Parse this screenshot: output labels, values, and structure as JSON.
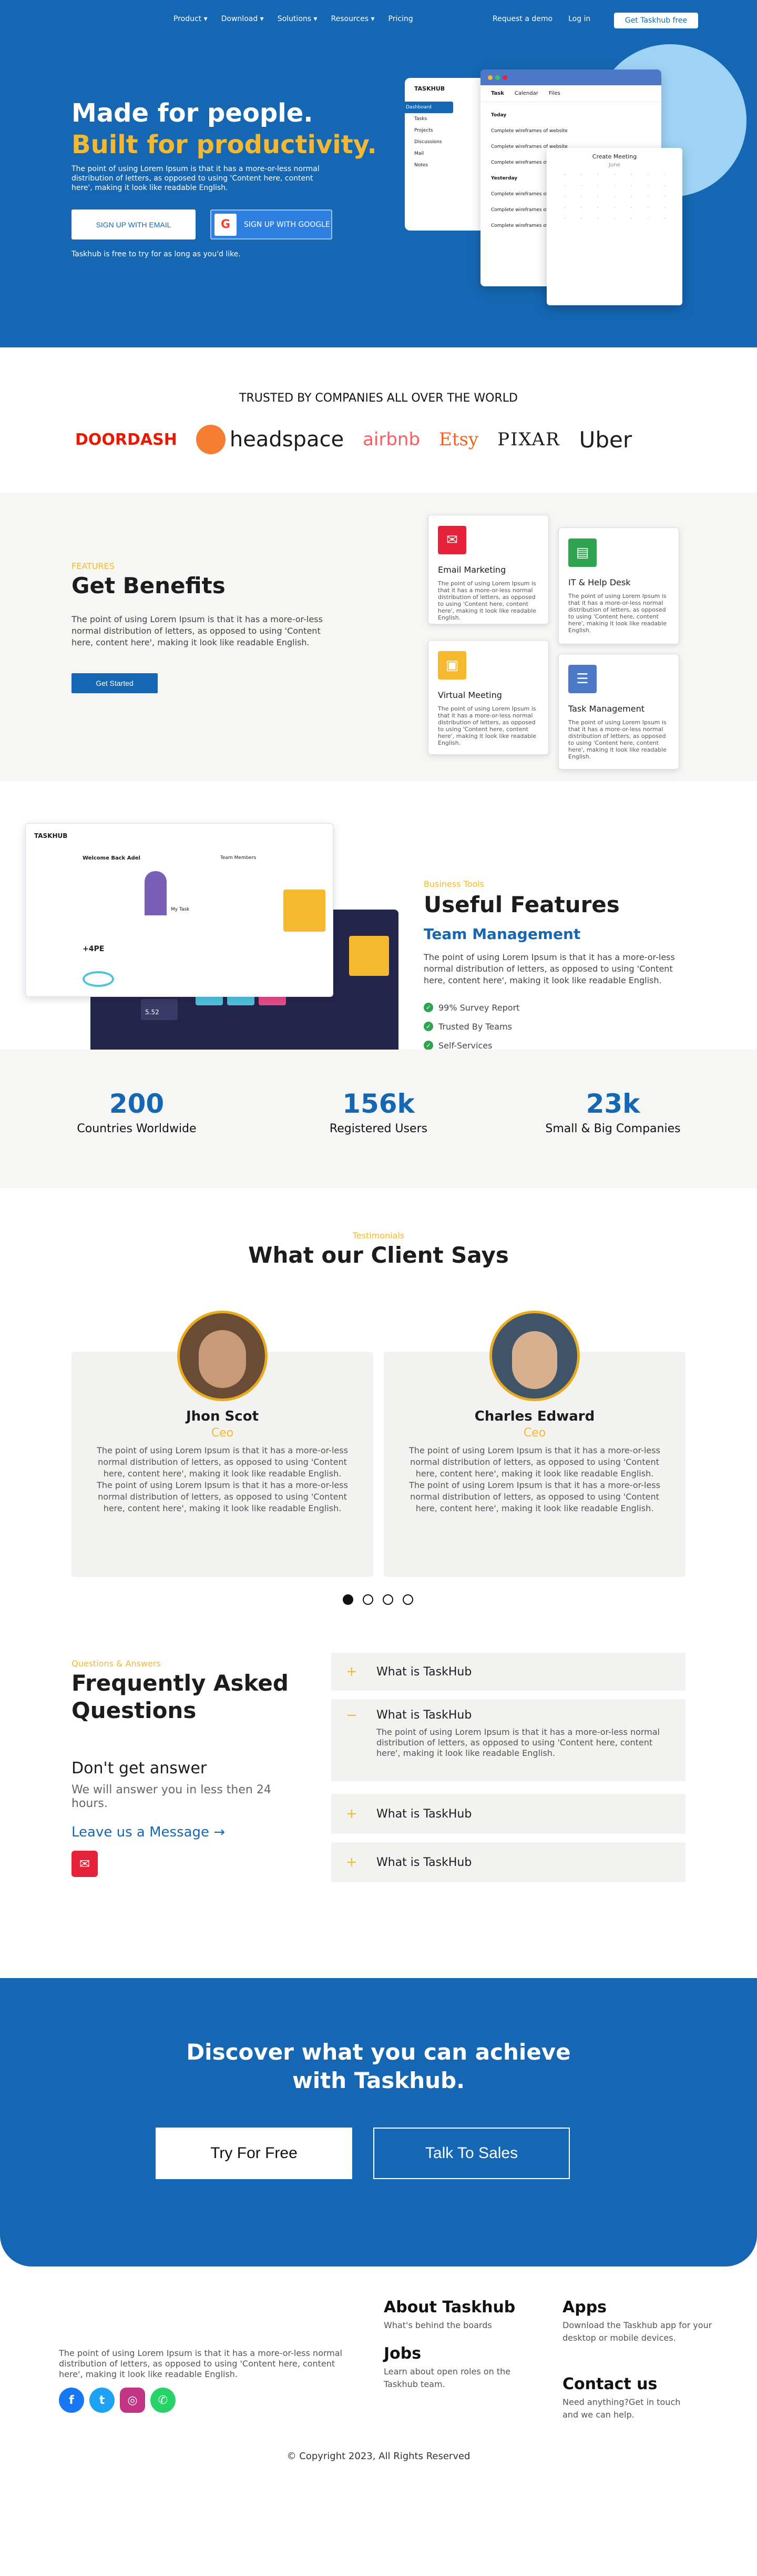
{
  "nav": {
    "links": [
      "Product ▾",
      "Download ▾",
      "Solutions ▾",
      "Resources ▾",
      "Pricing"
    ],
    "demo": "Request a demo",
    "login": "Log in",
    "cta": "Get Taskhub free"
  },
  "hero": {
    "line1": "Made for people.",
    "line2": "Built for productivity.",
    "desc": "The point of using Lorem Ipsum is that it has a more-or-less normal distribution of letters, as opposed to using 'Content here, content here', making it look like readable English.",
    "email_btn": "SIGN UP WITH EMAIL",
    "google_btn": "SIGN UP WITH GOOGLE",
    "note": "Taskhub is free to try for as long as you'd like.",
    "app": {
      "logo": "TASKHUB",
      "sidebar": [
        "Dashboard",
        "Tasks",
        "Projects",
        "Discussions",
        "Mail",
        "Notes"
      ],
      "tabs": [
        "Task",
        "Calendar",
        "Files"
      ],
      "today": "Today",
      "yesterday": "Yesterday",
      "item": "Complete wireframes of website",
      "cal_title": "Create Meeting",
      "cal_month": "June"
    }
  },
  "trusted": {
    "title": "TRUSTED BY COMPANIES ALL OVER THE WORLD",
    "logos": [
      "DOORDASH",
      "headspace",
      "airbnb",
      "Etsy",
      "PIXAR",
      "Uber"
    ]
  },
  "benefits": {
    "kicker": "FEATURES",
    "title": "Get Benefits",
    "desc": "The point of using Lorem Ipsum is that it has a more-or-less normal distribution of letters, as opposed to using 'Content here, content here', making it look like readable English.",
    "button": "Get Started",
    "card_text": "The point of using Lorem Ipsum is that it has a more-or-less normal distribution of letters, as opposed to using 'Content here, content here', making it look like readable English.",
    "cards": [
      "Email Marketing",
      "IT & Help Desk",
      "Virtual Meeting",
      "Task Management"
    ]
  },
  "features": {
    "kicker": "Business Tools",
    "title": "Useful Features",
    "subtitle": "Team Management",
    "desc": "The point of using Lorem Ipsum is that it has a more-or-less normal distribution of letters, as opposed to using 'Content here, content here', making it look like readable English.",
    "items": [
      "99% Survey Report",
      "Trusted By Teams",
      "Self-Services"
    ],
    "dash": {
      "welcome": "Welcome Back Adel",
      "team": "Team Members",
      "mytask": "My Task",
      "logo": "TASKHUB",
      "value": "+4PE",
      "value2": "5.52"
    }
  },
  "stats": [
    {
      "n": "200",
      "l": "Countries Worldwide"
    },
    {
      "n": "156k",
      "l": "Registered Users"
    },
    {
      "n": "23k",
      "l": "Small & Big Companies"
    }
  ],
  "testimonials": {
    "kicker": "Testimonials",
    "title": "What our Client Says",
    "quote": "The point of using Lorem Ipsum is that it has a more-or-less normal distribution of letters, as opposed to using 'Content here, content here', making it look like readable English. The point of using Lorem Ipsum is that it has a more-or-less normal distribution of letters, as opposed to using 'Content here, content here', making it look like readable English.",
    "people": [
      {
        "name": "Jhon Scot",
        "role": "Ceo"
      },
      {
        "name": "Charles Edward",
        "role": "Ceo"
      }
    ]
  },
  "faq": {
    "kicker": "Questions & Answers",
    "title": "Frequently Asked Questions",
    "sub": "Don't get answer",
    "desc": "We will answer you in less then 24 hours.",
    "link": "Leave us a Message →",
    "items": [
      {
        "q": "What is TaskHub",
        "a": "",
        "sym": "+"
      },
      {
        "q": "What is TaskHub",
        "a": "The point of using Lorem Ipsum is that it has a more-or-less normal distribution of letters, as opposed to using 'Content here, content here', making it look like readable English.",
        "sym": "−"
      },
      {
        "q": "What is TaskHub",
        "a": "",
        "sym": "+"
      },
      {
        "q": "What is TaskHub",
        "a": "",
        "sym": "+"
      }
    ]
  },
  "cta": {
    "line1": "Discover what you can achieve",
    "line2": "with Taskhub.",
    "b1": "Try For Free",
    "b2": "Talk To Sales"
  },
  "footer": {
    "about": "The point of using Lorem Ipsum is that it has a more-or-less normal distribution of letters, as opposed to using 'Content here, content here', making it look like readable English.",
    "cols": [
      {
        "h": "About Taskhub",
        "t": "What's behind the boards"
      },
      {
        "h": "Jobs",
        "t": "Learn about open roles on the Taskhub team."
      },
      {
        "h": "Apps",
        "t": "Download the Taskhub app for your desktop or mobile devices."
      },
      {
        "h": "Contact us",
        "t": "Need anything?Get in touch and we can help."
      }
    ],
    "copyright": "© Copyright 2023, All Rights Reserved"
  }
}
